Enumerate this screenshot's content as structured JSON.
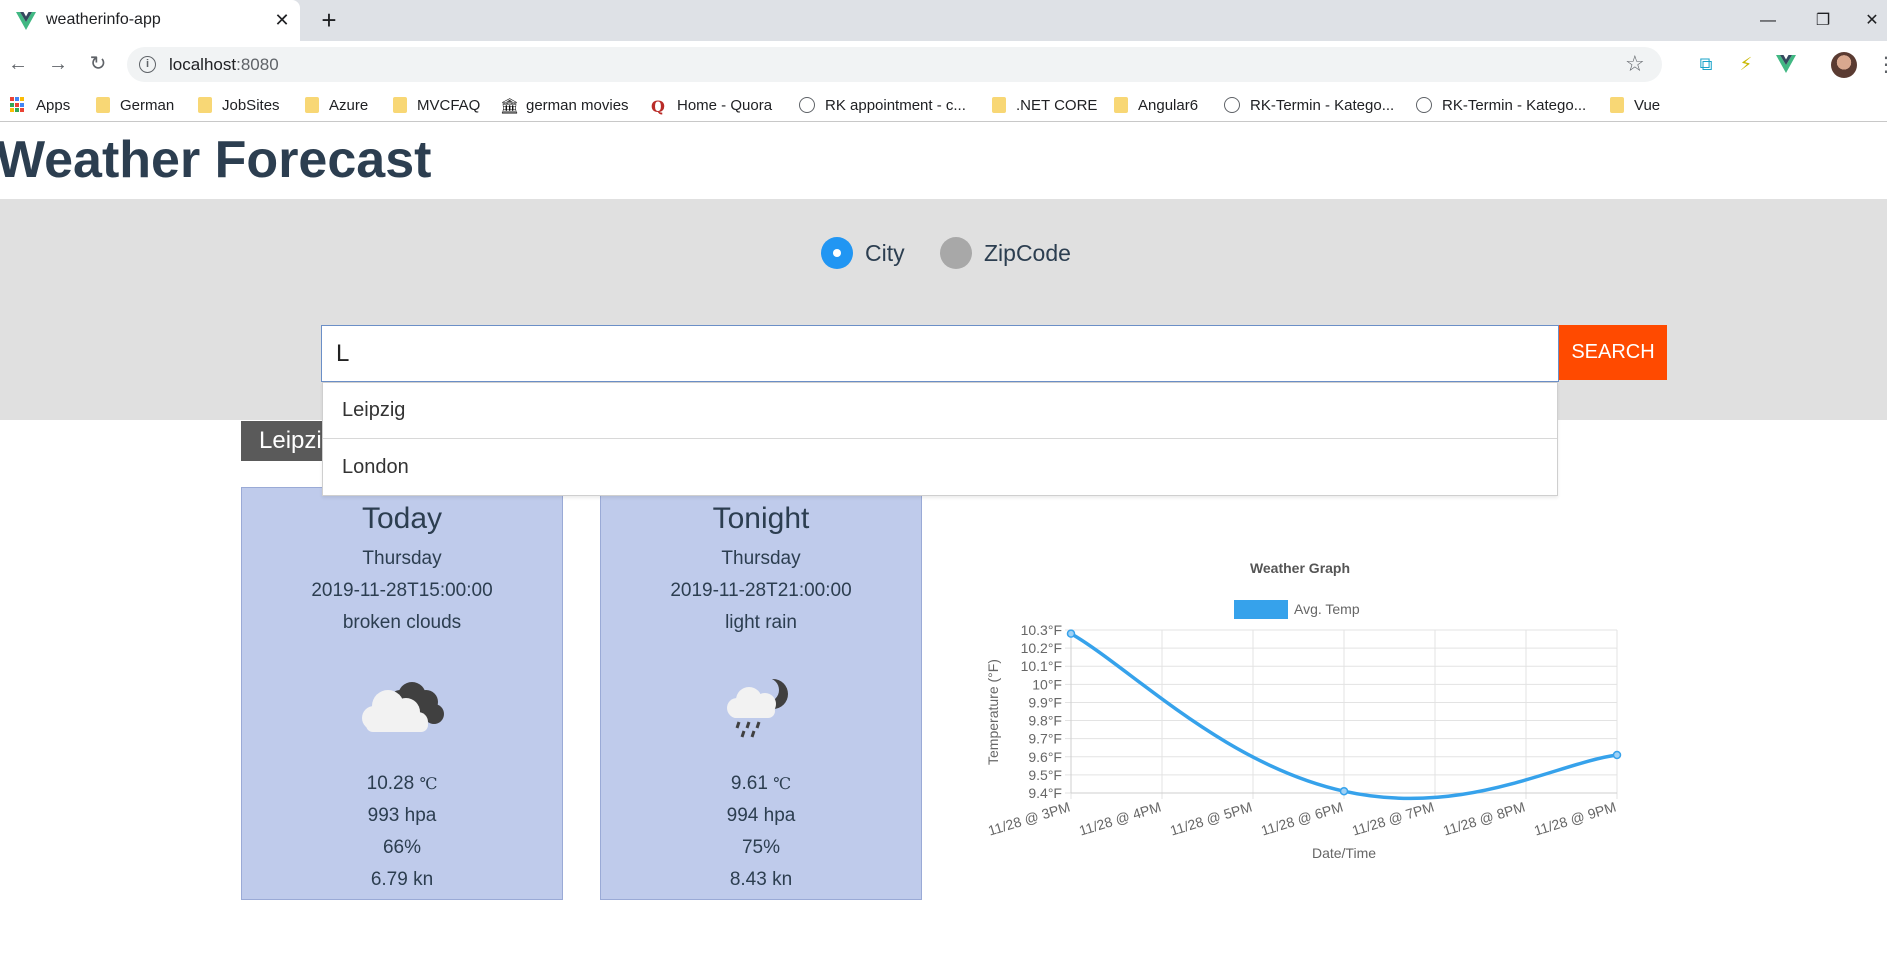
{
  "browser": {
    "tab_title": "weatherinfo-app",
    "url_host": "localhost",
    "url_port": ":8080",
    "bookmarks": [
      {
        "label": "Apps",
        "icon": "apps-grid-icon"
      },
      {
        "label": "German",
        "icon": "folder-icon"
      },
      {
        "label": "JobSites",
        "icon": "folder-icon"
      },
      {
        "label": "Azure",
        "icon": "folder-icon"
      },
      {
        "label": "MVCFAQ",
        "icon": "folder-icon"
      },
      {
        "label": "german movies",
        "icon": "museum-icon"
      },
      {
        "label": "Home - Quora",
        "icon": "quora-icon"
      },
      {
        "label": "RK appointment - c...",
        "icon": "globe-icon"
      },
      {
        "label": ".NET CORE",
        "icon": "folder-icon"
      },
      {
        "label": "Angular6",
        "icon": "folder-icon"
      },
      {
        "label": "RK-Termin - Katego...",
        "icon": "globe-icon"
      },
      {
        "label": "RK-Termin - Katego...",
        "icon": "globe-icon"
      },
      {
        "label": "Vue",
        "icon": "folder-icon"
      }
    ]
  },
  "page": {
    "title": "Weather Forecast",
    "search_mode": {
      "options": [
        {
          "label": "City",
          "selected": true
        },
        {
          "label": "ZipCode",
          "selected": false
        }
      ]
    },
    "search": {
      "value": "L",
      "button_label": "SEARCH",
      "button_color": "#ff4a00",
      "suggestions": [
        "Leipzig",
        "London"
      ]
    },
    "city_badge": "Leipzig",
    "cards": [
      {
        "title": "Today",
        "day": "Thursday",
        "datetime": "2019-11-28T15:00:00",
        "description": "broken clouds",
        "icon": "broken-clouds-icon",
        "temp": "10.28",
        "temp_unit": "℃",
        "pressure": "993 hpa",
        "humidity": "66%",
        "wind": "6.79 kn"
      },
      {
        "title": "Tonight",
        "day": "Thursday",
        "datetime": "2019-11-28T21:00:00",
        "description": "light rain",
        "icon": "light-rain-night-icon",
        "temp": "9.61",
        "temp_unit": "℃",
        "pressure": "994 hpa",
        "humidity": "75%",
        "wind": "8.43 kn"
      }
    ]
  },
  "chart_data": {
    "type": "line",
    "title": "Weather Graph",
    "xlabel": "Date/Time",
    "ylabel": "Temperature (°F)",
    "categories": [
      "11/28 @ 3PM",
      "11/28 @ 4PM",
      "11/28 @ 5PM",
      "11/28 @ 6PM",
      "11/28 @ 7PM",
      "11/28 @ 8PM",
      "11/28 @ 9PM"
    ],
    "series": [
      {
        "name": "Avg. Temp",
        "color": "#36a2eb",
        "points": [
          {
            "x": "11/28 @ 3PM",
            "y": 10.28
          },
          {
            "x": "11/28 @ 6PM",
            "y": 9.41
          },
          {
            "x": "11/28 @ 9PM",
            "y": 9.61
          }
        ]
      }
    ],
    "yticks": [
      "10.3°F",
      "10.2°F",
      "10.1°F",
      "10°F",
      "9.9°F",
      "9.8°F",
      "9.7°F",
      "9.6°F",
      "9.5°F",
      "9.4°F"
    ],
    "ylim": [
      9.4,
      10.3
    ],
    "grid": true,
    "legend": "top"
  }
}
